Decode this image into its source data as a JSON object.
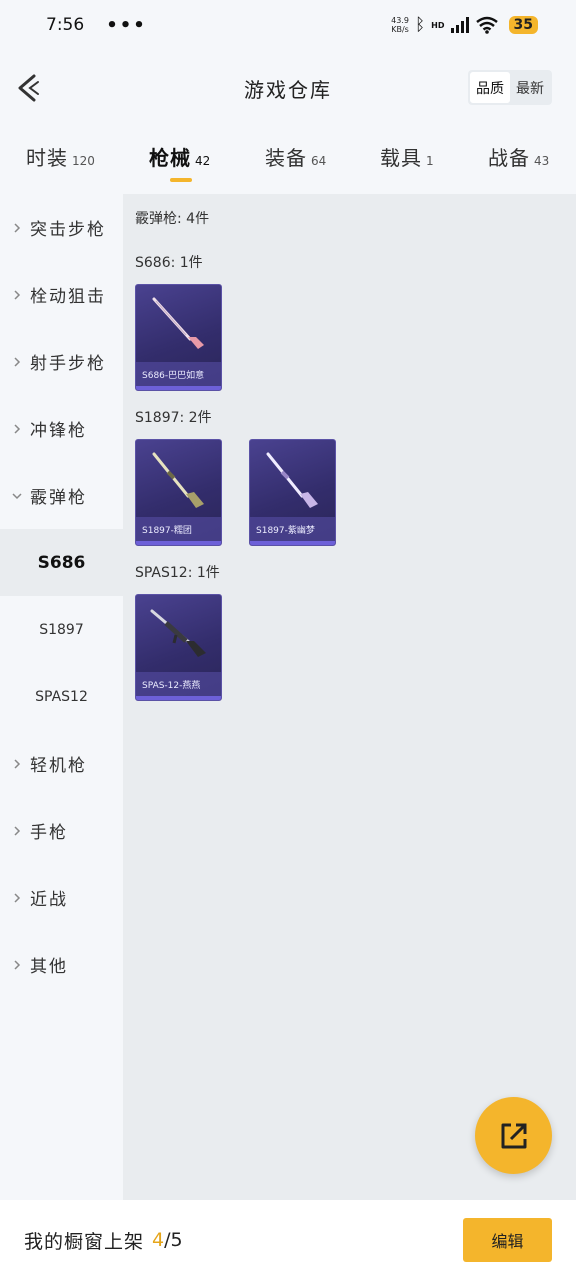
{
  "status_bar": {
    "time": "7:56",
    "dots": "•••",
    "net_speed_value": "43.9",
    "net_speed_unit": "KB/s",
    "hd_label": "HD",
    "battery": "35"
  },
  "header": {
    "title": "游戏仓库",
    "sort_options": [
      "品质",
      "最新"
    ],
    "sort_selected": "品质"
  },
  "tabs": [
    {
      "label": "时装",
      "count": "120"
    },
    {
      "label": "枪械",
      "count": "42"
    },
    {
      "label": "装备",
      "count": "64"
    },
    {
      "label": "载具",
      "count": "1"
    },
    {
      "label": "战备",
      "count": "43"
    }
  ],
  "active_tab": "枪械",
  "sidebar": {
    "categories": [
      "突击步枪",
      "栓动狙击",
      "射手步枪",
      "冲锋枪",
      "霰弹枪"
    ],
    "expanded_category": "霰弹枪",
    "subcategories": [
      "S686",
      "S1897",
      "SPAS12"
    ],
    "selected_subcategory": "S686",
    "more_categories": [
      "轻机枪",
      "手枪",
      "近战",
      "其他"
    ]
  },
  "content": {
    "group_title": "霰弹枪: 4件",
    "groups": [
      {
        "title": "S686: 1件",
        "items": [
          {
            "name": "S686-巴巴如意",
            "icon": "shotgun-icon"
          }
        ]
      },
      {
        "title": "S1897: 2件",
        "items": [
          {
            "name": "S1897-糯团",
            "icon": "shotgun-icon"
          },
          {
            "name": "S1897-紫幽梦",
            "icon": "shotgun-icon"
          }
        ]
      },
      {
        "title": "SPAS12: 1件",
        "items": [
          {
            "name": "SPAS-12-燕燕",
            "icon": "shotgun-icon"
          }
        ]
      }
    ]
  },
  "fab": {
    "icon": "share-icon"
  },
  "bottom_bar": {
    "label": "我的橱窗上架",
    "count_current": "4",
    "count_total": "/5",
    "edit_button": "编辑"
  },
  "colors": {
    "accent": "#f4b52c",
    "card_bg": "#3a3378",
    "content_bg": "#e9ecef"
  }
}
